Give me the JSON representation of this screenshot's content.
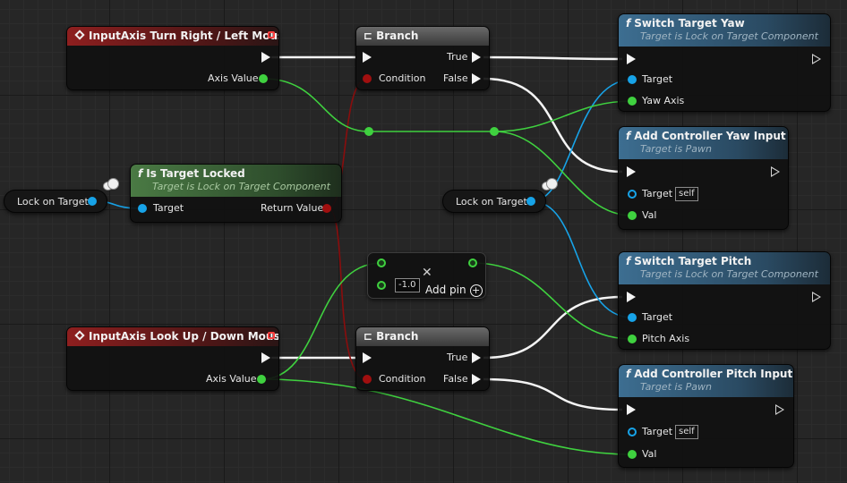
{
  "nodes": {
    "input_turn": {
      "title": "InputAxis Turn Right / Left Mouse",
      "axis_label": "Axis Value"
    },
    "input_look": {
      "title": "InputAxis Look Up / Down Mouse",
      "axis_label": "Axis Value"
    },
    "branch_top": {
      "title": "Branch",
      "condition_label": "Condition",
      "true_label": "True",
      "false_label": "False"
    },
    "branch_bottom": {
      "title": "Branch",
      "condition_label": "Condition",
      "true_label": "True",
      "false_label": "False"
    },
    "is_target_locked": {
      "title": "Is Target Locked",
      "subtitle": "Target is Lock on Target Component",
      "target_label": "Target",
      "return_label": "Return Value"
    },
    "switch_yaw": {
      "title": "Switch Target Yaw",
      "subtitle": "Target is Lock on Target Component",
      "target_label": "Target",
      "axis_label": "Yaw Axis"
    },
    "add_yaw": {
      "title": "Add Controller Yaw Input",
      "subtitle": "Target is Pawn",
      "target_label": "Target",
      "self_label": "self",
      "val_label": "Val"
    },
    "switch_pitch": {
      "title": "Switch Target Pitch",
      "subtitle": "Target is Lock on Target Component",
      "target_label": "Target",
      "axis_label": "Pitch Axis"
    },
    "add_pitch": {
      "title": "Add Controller Pitch Input",
      "subtitle": "Target is Pawn",
      "target_label": "Target",
      "self_label": "self",
      "val_label": "Val"
    },
    "multiply": {
      "value": "-1.0",
      "add_pin_label": "Add pin",
      "symbol": "✕"
    }
  },
  "variables": {
    "lock_left": {
      "label": "Lock on Target"
    },
    "lock_mid": {
      "label": "Lock on Target"
    }
  },
  "glyphs": {
    "function": "f",
    "branch": "⊏",
    "add": "+"
  },
  "colors": {
    "exec": "#f4f4f4",
    "float": "#3fd13f",
    "object": "#17a3e8",
    "bool": "#a00f0f",
    "event_header": "#8e1f1f",
    "function_header": "#3d6e91",
    "pure_header": "#4a7a44",
    "branch_header": "#5a5a5a"
  }
}
